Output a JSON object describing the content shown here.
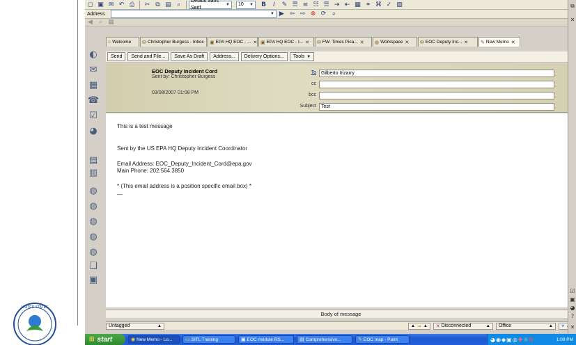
{
  "toolbar": {
    "font_name": "Default Sans Serif",
    "font_size": "10"
  },
  "address_bar": {
    "label": "Address"
  },
  "tabs": [
    {
      "label": "Welcome",
      "icon": "home-icon"
    },
    {
      "label": "Christopher Burgess - Inbox",
      "icon": "inbox-icon"
    },
    {
      "label": "EPA HQ EOC - ...",
      "icon": "mailbox-icon"
    },
    {
      "label": "EPA HQ EOC - I...",
      "icon": "mailbox-icon"
    },
    {
      "label": "FW: Times Pica...",
      "icon": "message-icon"
    },
    {
      "label": "Workspace",
      "icon": "workspace-icon"
    },
    {
      "label": "EOC Deputy Inc...",
      "icon": "message-icon"
    },
    {
      "label": "New Memo",
      "icon": "memo-icon"
    }
  ],
  "message_toolbar": {
    "send": "Send",
    "send_and_file": "Send and File...",
    "save_as_draft": "Save As Draft",
    "address": "Address...",
    "delivery_options": "Delivery Options...",
    "tools": "Tools"
  },
  "header": {
    "sender_name": "EOC Deputy Incident Cord",
    "sent_by": "Sent by: Christopher Burgess",
    "date": "03/08/2007 01:08 PM",
    "to_label": "To",
    "to_value": "Gilberto Irizarry",
    "cc_label": "cc",
    "cc_value": "",
    "bcc_label": "bcc",
    "bcc_value": "",
    "subject_label": "Subject",
    "subject_value": "Test"
  },
  "body": {
    "line1": "This is a test message",
    "line2": "Sent by the US EPA HQ Deputy Incident Coordinator",
    "line3": "Email Address:  EOC_Deputy_Incident_Cord@epa.gov",
    "line4": "Main Phone:  202.564.3850",
    "line5": "* (This email address is a position specific email box) *",
    "line6": "—"
  },
  "body_label": "Body of message",
  "status_bar": {
    "category": "Untagged",
    "connection": "Disconnected",
    "location": "Office"
  },
  "taskbar": {
    "start": "start",
    "items": [
      {
        "label": "New Memo - Lo...",
        "active": true
      },
      {
        "label": "SITL Training",
        "active": false
      },
      {
        "label": "EOC module RS...",
        "active": false
      },
      {
        "label": "Comprehensive...",
        "active": false
      },
      {
        "label": "EOC map - Paint",
        "active": false
      }
    ],
    "clock": "1:09 PM"
  },
  "seal": {
    "text": "UNITED STATES"
  },
  "colors": {
    "taskbar_blue": "#2260d9",
    "start_green": "#2e8a2e",
    "header_tan": "#d8d4b6"
  }
}
